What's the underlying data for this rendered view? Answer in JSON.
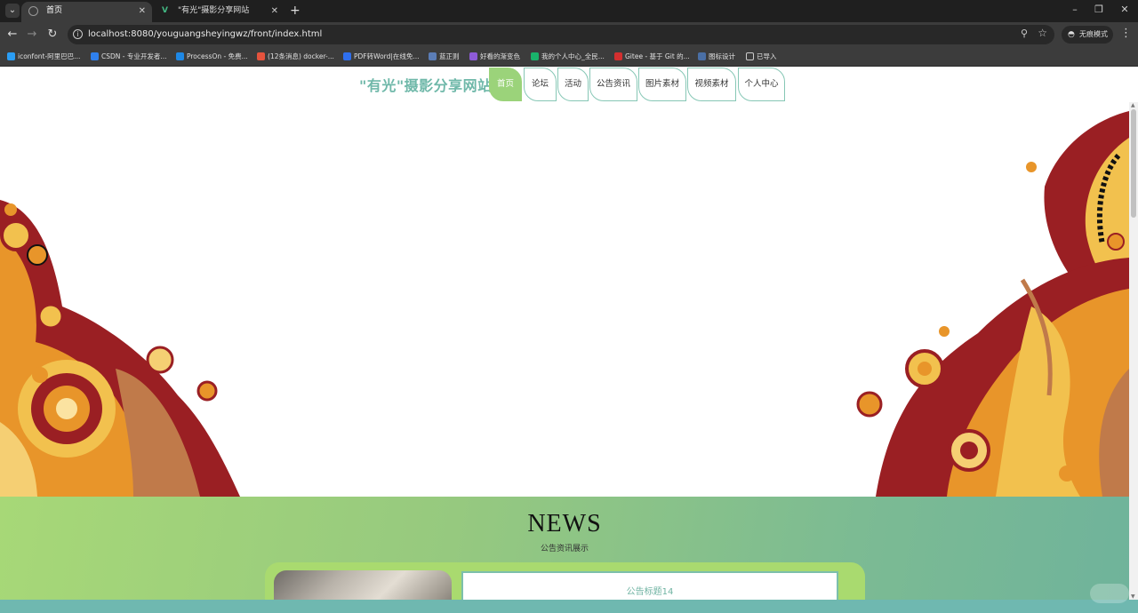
{
  "browser": {
    "tabs": [
      {
        "title": "首页",
        "active": true
      },
      {
        "title": "\"有光\"摄影分享网站",
        "active": false
      }
    ],
    "url": "localhost:8080/youguangsheyingwz/front/index.html",
    "incognito_label": "无痕模式",
    "bookmarks": [
      {
        "label": "iconfont-阿里巴巴...",
        "color": "#2a9df4"
      },
      {
        "label": "CSDN - 专业开发者...",
        "color": "#2f80ed"
      },
      {
        "label": "ProcessOn - 免费...",
        "color": "#1e88e5"
      },
      {
        "label": "(12条消息) docker-...",
        "color": "#e5533d"
      },
      {
        "label": "PDF转Word|在线免...",
        "color": "#2f6fed"
      },
      {
        "label": "蓝正则",
        "color": "#5b7db6"
      },
      {
        "label": "好看的渐变色",
        "color": "#8e5bd8"
      },
      {
        "label": "我的个人中心_全民...",
        "color": "#19b36b"
      },
      {
        "label": "Gitee - 基于 Git 的...",
        "color": "#d32f2f"
      },
      {
        "label": "图标设计",
        "color": "#4a6fa5"
      },
      {
        "label": "已导入",
        "color": "#3c3c3c"
      }
    ]
  },
  "site": {
    "title": "\"有光\"摄影分享网站",
    "nav": [
      {
        "label": "首页",
        "active": true
      },
      {
        "label": "论坛",
        "active": false
      },
      {
        "label": "活动",
        "active": false
      },
      {
        "label": "公告资讯",
        "active": false
      },
      {
        "label": "图片素材",
        "active": false
      },
      {
        "label": "视频素材",
        "active": false
      },
      {
        "label": "个人中心",
        "active": false
      }
    ],
    "carousel": {
      "slide_count": 3,
      "active_index": 0
    }
  },
  "news": {
    "heading": "NEWS",
    "subheading": "公告资讯展示",
    "items": [
      {
        "title": "公告标题14"
      }
    ]
  },
  "colors": {
    "accent_green": "#9bd37a",
    "accent_teal": "#6fb8a9",
    "paisley_red": "#9a1f23",
    "paisley_orange": "#e8952a",
    "paisley_gold": "#f2c14e"
  }
}
